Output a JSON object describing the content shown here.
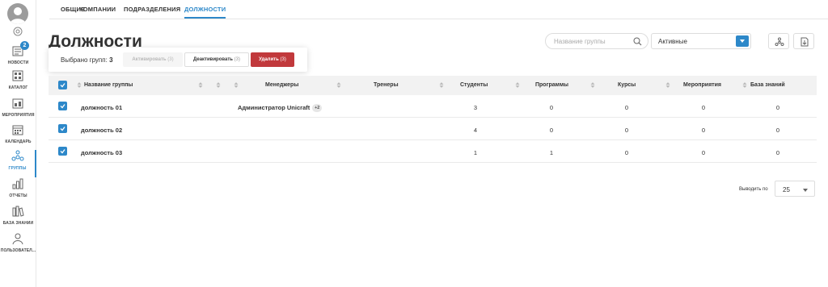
{
  "sidebar": {
    "items": [
      {
        "label": "НОВОСТИ",
        "icon": "news-icon",
        "badge": "2"
      },
      {
        "label": "КАТАЛОГ",
        "icon": "catalog-icon"
      },
      {
        "label": "МЕРОПРИЯТИЯ",
        "icon": "events-icon"
      },
      {
        "label": "КАЛЕНДАРЬ",
        "icon": "calendar-icon"
      },
      {
        "label": "ГРУППЫ",
        "icon": "groups-icon",
        "active": true
      },
      {
        "label": "ОТЧЕТЫ",
        "icon": "reports-icon"
      },
      {
        "label": "БАЗА ЗНАНИЙ",
        "icon": "knowledge-base-icon"
      },
      {
        "label": "ПОЛЬЗОВАТЕЛ...",
        "icon": "users-icon"
      }
    ]
  },
  "tabs": [
    {
      "label": "ОБЩИЕ"
    },
    {
      "label": "КОМПАНИИ"
    },
    {
      "label": "ПОДРАЗДЕЛЕНИЯ"
    },
    {
      "label": "ДОЛЖНОСТИ",
      "active": true
    }
  ],
  "page": {
    "title": "Должности"
  },
  "search": {
    "placeholder": "Название группы"
  },
  "status_select": {
    "value": "Активные"
  },
  "selection": {
    "label": "Выбрано групп:",
    "count": "3",
    "activate_label": "Активировать",
    "activate_count": "(3)",
    "deactivate_label": "Деактивировать",
    "deactivate_count": "(3)",
    "delete_label": "Удалить",
    "delete_count": "(3)"
  },
  "table": {
    "columns": [
      "Название группы",
      "Менеджеры",
      "Тренеры",
      "Студенты",
      "Программы",
      "Курсы",
      "Мероприятия",
      "База знаний"
    ],
    "rows": [
      {
        "name": "должность 01",
        "managers": "Администратор Unicraft",
        "managers_more": "+2",
        "trainers": "",
        "students": "3",
        "programs": "0",
        "courses": "0",
        "events": "0",
        "knowledge": "0"
      },
      {
        "name": "должность 02",
        "managers": "",
        "managers_more": "",
        "trainers": "",
        "students": "4",
        "programs": "0",
        "courses": "0",
        "events": "0",
        "knowledge": "0"
      },
      {
        "name": "должность 03",
        "managers": "",
        "managers_more": "",
        "trainers": "",
        "students": "1",
        "programs": "1",
        "courses": "0",
        "events": "0",
        "knowledge": "0"
      }
    ]
  },
  "pagination": {
    "label": "Выводить по",
    "value": "25"
  },
  "colors": {
    "accent": "#2d88c9",
    "danger": "#c1393c"
  }
}
